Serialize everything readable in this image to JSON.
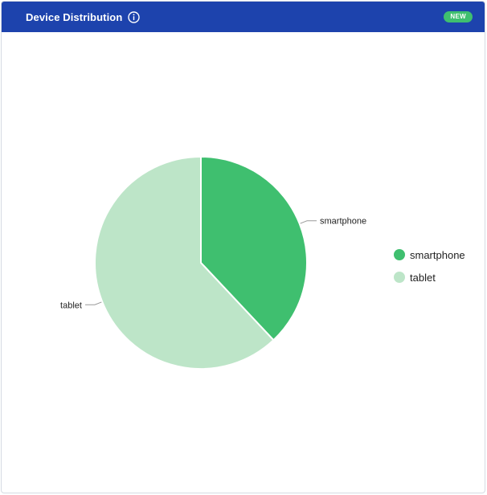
{
  "header": {
    "title": "Device Distribution",
    "badge": "NEW",
    "info_icon": "info-circle-icon",
    "background": "#1d43ad"
  },
  "chart_data": {
    "type": "pie",
    "title": "Device Distribution",
    "slices": [
      {
        "label": "smartphone",
        "value": 38,
        "color": "#3fbf6f"
      },
      {
        "label": "tablet",
        "value": 62,
        "color": "#bde5c8"
      }
    ],
    "legend_position": "right"
  },
  "legend": {
    "items": [
      {
        "label": "smartphone",
        "color": "#3fbf6f"
      },
      {
        "label": "tablet",
        "color": "#bde5c8"
      }
    ]
  }
}
